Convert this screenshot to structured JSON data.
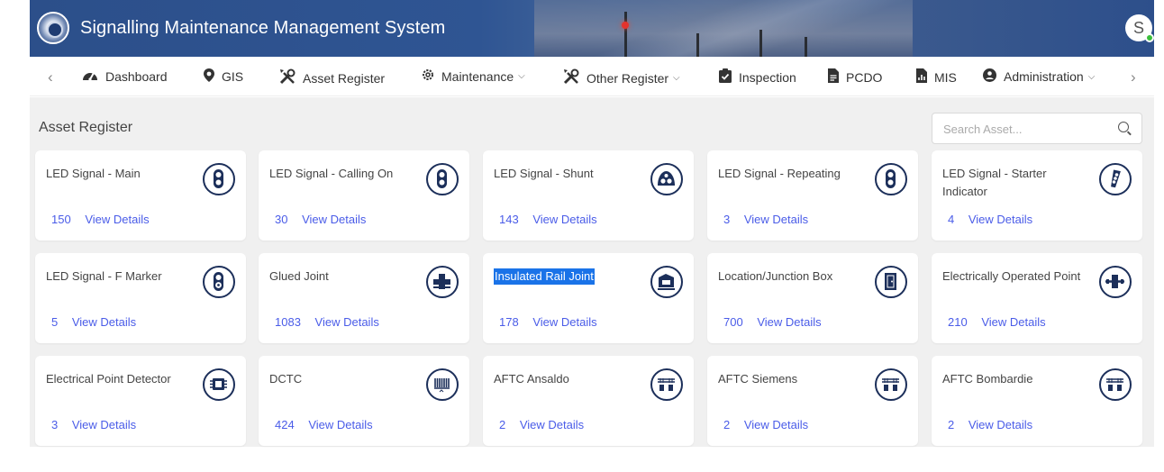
{
  "app": {
    "title": "Signalling Maintenance Management System",
    "user_initial": "S"
  },
  "nav": {
    "items": [
      {
        "label": "Dashboard",
        "icon": "dashboard-icon"
      },
      {
        "label": "GIS",
        "icon": "map-pin-icon"
      },
      {
        "label": "Asset Register",
        "icon": "tools-icon"
      },
      {
        "label": "Maintenance",
        "icon": "gear-icon",
        "dropdown": true
      },
      {
        "label": "Other Register",
        "icon": "tools-icon",
        "dropdown": true
      },
      {
        "label": "Inspection",
        "icon": "clipboard-check-icon"
      },
      {
        "label": "PCDO",
        "icon": "document-icon"
      },
      {
        "label": "MIS",
        "icon": "report-icon"
      },
      {
        "label": "Administration",
        "icon": "user-circle-icon",
        "dropdown": true
      }
    ]
  },
  "page": {
    "title": "Asset Register"
  },
  "search": {
    "placeholder": "Search Asset..."
  },
  "assets": [
    {
      "name": "LED Signal - Main",
      "count": "150",
      "link": "View Details",
      "icon": "signal-icon"
    },
    {
      "name": "LED Signal - Calling On",
      "count": "30",
      "link": "View Details",
      "icon": "signal-icon"
    },
    {
      "name": "LED Signal - Shunt",
      "count": "143",
      "link": "View Details",
      "icon": "shunt-signal-icon"
    },
    {
      "name": "LED Signal - Repeating",
      "count": "3",
      "link": "View Details",
      "icon": "signal-icon"
    },
    {
      "name": "LED Signal - Starter Indicator",
      "count": "4",
      "link": "View Details",
      "icon": "starter-indicator-icon"
    },
    {
      "name": "LED Signal - F Marker",
      "count": "5",
      "link": "View Details",
      "icon": "f-marker-icon"
    },
    {
      "name": "Glued Joint",
      "count": "1083",
      "link": "View Details",
      "icon": "glued-joint-icon"
    },
    {
      "name": "Insulated Rail Joint",
      "count": "178",
      "link": "View Details",
      "icon": "rail-joint-icon",
      "highlighted": true
    },
    {
      "name": "Location/Junction Box",
      "count": "700",
      "link": "View Details",
      "icon": "junction-box-icon"
    },
    {
      "name": "Electrically Operated Point",
      "count": "210",
      "link": "View Details",
      "icon": "point-machine-icon"
    },
    {
      "name": "Electrical Point Detector",
      "count": "3",
      "link": "View Details",
      "icon": "point-detector-icon"
    },
    {
      "name": "DCTC",
      "count": "424",
      "link": "View Details",
      "icon": "dctc-icon"
    },
    {
      "name": "AFTC Ansaldo",
      "count": "2",
      "link": "View Details",
      "icon": "aftc-icon"
    },
    {
      "name": "AFTC Siemens",
      "count": "2",
      "link": "View Details",
      "icon": "aftc-icon"
    },
    {
      "name": "AFTC Bombardie",
      "count": "2",
      "link": "View Details",
      "icon": "aftc-icon"
    }
  ],
  "colors": {
    "header": "#2f5593",
    "link": "#4a5ce8",
    "icon_stroke": "#1c2f5a",
    "highlight": "#1a73e8"
  }
}
